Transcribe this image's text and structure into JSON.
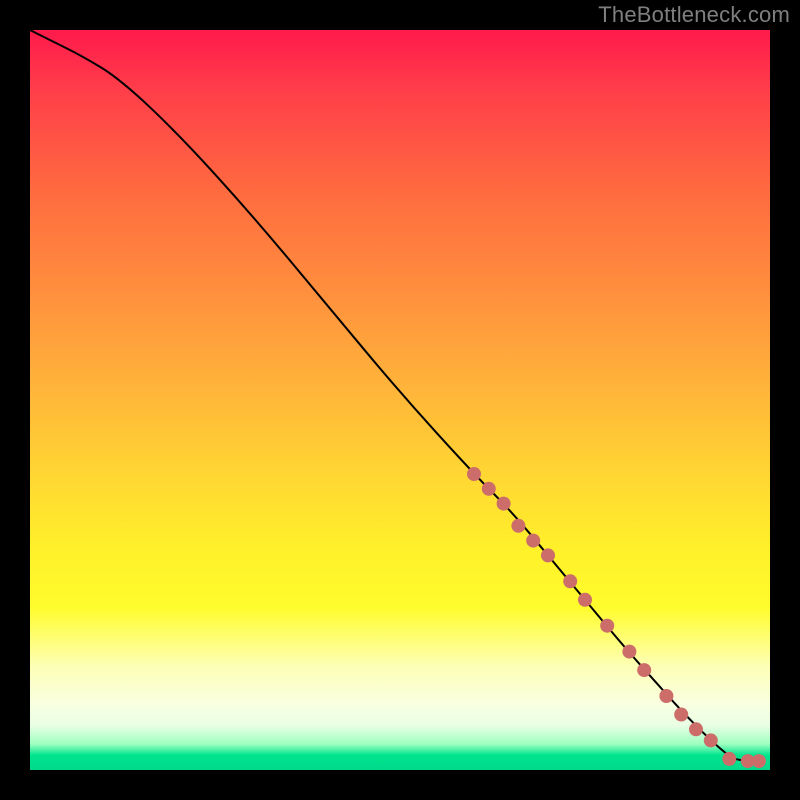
{
  "watermark": "TheBottleneck.com",
  "colors": {
    "page_bg": "#000000",
    "watermark": "#7f7f7f",
    "curve": "#000000",
    "dot": "#cc6d6a",
    "gradient_top": "#ff1a4b",
    "gradient_mid": "#fff02a",
    "gradient_bottom": "#00d98a"
  },
  "chart_data": {
    "type": "line",
    "title": "",
    "xlabel": "",
    "ylabel": "",
    "xlim": [
      0,
      100
    ],
    "ylim": [
      0,
      100
    ],
    "grid": false,
    "legend": false,
    "line": {
      "x": [
        0,
        3,
        7,
        12,
        20,
        30,
        40,
        50,
        60,
        65,
        70,
        75,
        80,
        84,
        88,
        92,
        94,
        95,
        97,
        99
      ],
      "y": [
        100,
        98.5,
        96.5,
        93.5,
        86,
        75,
        63,
        51,
        40,
        35,
        29,
        23,
        17,
        12.5,
        8,
        4,
        2.3,
        1.5,
        1.2,
        1.2
      ]
    },
    "points": {
      "x": [
        60,
        62,
        64,
        66,
        68,
        70,
        73,
        75,
        78,
        81,
        83,
        86,
        88,
        90,
        92,
        94.5,
        97,
        98.5
      ],
      "y": [
        40,
        38,
        36,
        33,
        31,
        29,
        25.5,
        23,
        19.5,
        16,
        13.5,
        10,
        7.5,
        5.5,
        4,
        1.5,
        1.2,
        1.2
      ]
    }
  }
}
